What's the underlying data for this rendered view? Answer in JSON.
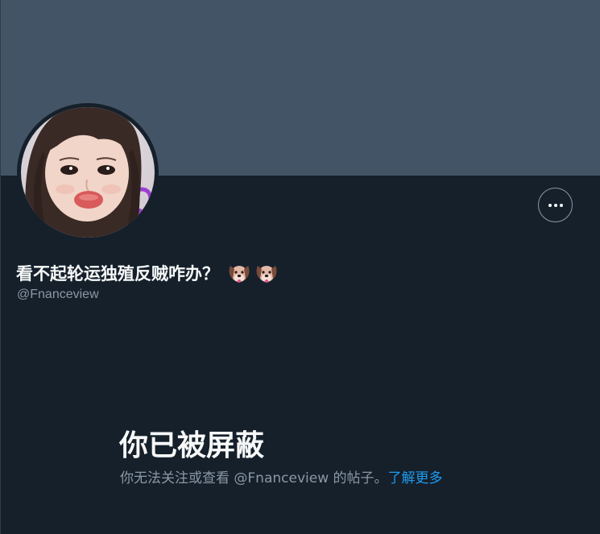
{
  "profile": {
    "display_name": "看不起轮运独殖反贼咋办？",
    "name_emojis": [
      "dog-face-emoji",
      "dog-face-emoji"
    ],
    "handle": "@Fnanceview",
    "more_icon": "more-horizontal-icon"
  },
  "blocked": {
    "title": "你已被屏蔽",
    "description": "你无法关注或查看 @Fnanceview 的帖子。",
    "learn_more": "了解更多"
  },
  "colors": {
    "background": "#15202b",
    "banner": "#435466",
    "primary_text": "#f7f9f9",
    "secondary_text": "#8b98a5",
    "link": "#1d9bf0"
  }
}
